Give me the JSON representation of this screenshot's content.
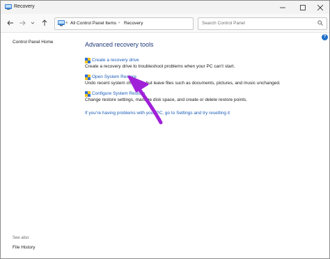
{
  "window": {
    "title": "Recovery"
  },
  "address_bar": {
    "segments": [
      "All Control Panel Items",
      "Recovery"
    ],
    "prefix": "«"
  },
  "search": {
    "placeholder": "Search Control Panel"
  },
  "left_pane": {
    "home_link": "Control Panel Home",
    "see_also_label": "See also",
    "see_also_items": [
      "File History"
    ]
  },
  "main": {
    "section_title": "Advanced recovery tools",
    "tools": [
      {
        "link": "Create a recovery drive",
        "description": "Create a recovery drive to troubleshoot problems when your PC can’t start."
      },
      {
        "link": "Open System Restore",
        "description": "Undo recent system changes, but leave files such as documents, pictures, and music unchanged."
      },
      {
        "link": "Configure System Restore",
        "description": "Change restore settings, manage disk space, and create or delete restore points."
      }
    ],
    "reset_link": "If you’re having problems with your PC, go to Settings and try resetting it"
  },
  "help": {
    "label": "?"
  },
  "colors": {
    "link": "#1a5bb8",
    "heading": "#1e3a78",
    "annotation_arrow": "#a020d8"
  }
}
